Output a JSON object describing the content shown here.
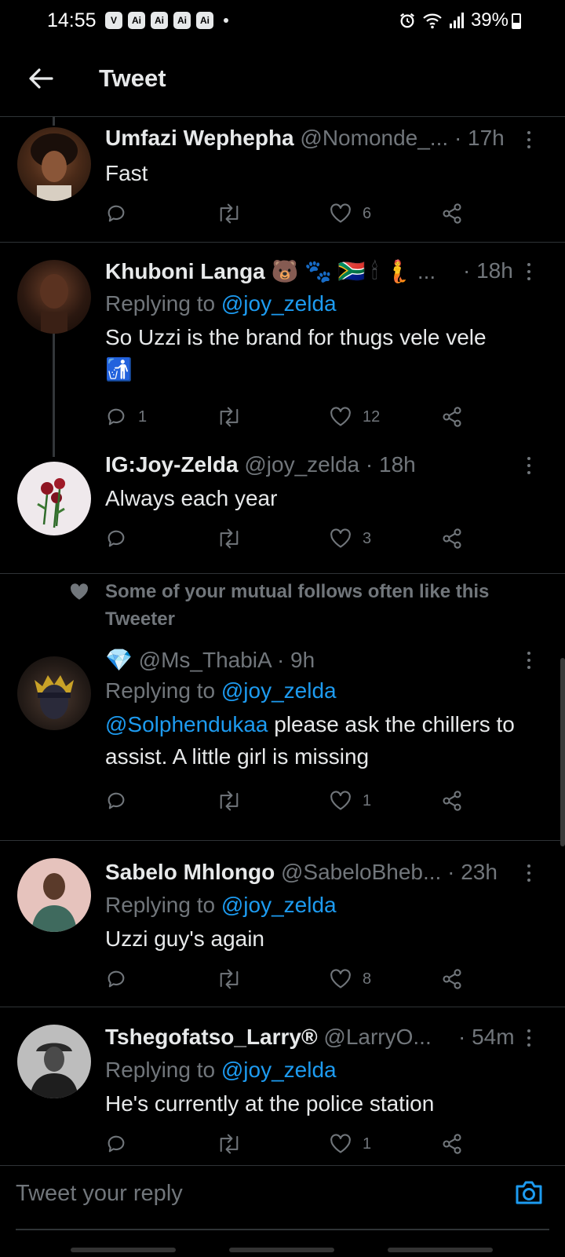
{
  "status_bar": {
    "time": "14:55",
    "apps": [
      "V",
      "Ai",
      "Ai",
      "Ai",
      "Ai"
    ],
    "battery": "39%"
  },
  "header": {
    "title": "Tweet"
  },
  "social_context": {
    "text": "Some of your mutual follows often like this Tweeter"
  },
  "tweets": [
    {
      "name": "Umfazi Wephepha",
      "handle": "@Nomonde_...",
      "time": "· 17h",
      "text": "Fast",
      "replies": "",
      "likes": "6"
    },
    {
      "name": "Khuboni Langa",
      "name_emoji": "🐻 🐾 🇿🇦 🕯 🧜 ...",
      "handle": "",
      "time": "· 18h",
      "replying_prefix": "Replying to",
      "replying_to": "@joy_zelda",
      "text": "So Uzzi is the brand for thugs vele vele",
      "text_emoji": "🚮",
      "replies": "1",
      "likes": "12"
    },
    {
      "name": "IG:Joy-Zelda",
      "handle": "@joy_zelda",
      "time": "· 18h",
      "text": "Always each year",
      "replies": "",
      "likes": "3"
    },
    {
      "name": "💎",
      "handle": "@Ms_ThabiA",
      "time": "· 9h",
      "replying_prefix": "Replying to",
      "replying_to": "@joy_zelda",
      "text_mention": "@Solphendukaa",
      "text": " please ask the chillers to assist. A little girl is missing",
      "replies": "",
      "likes": "1"
    },
    {
      "name": "Sabelo Mhlongo",
      "handle": "@SabeloBheb...",
      "time": "· 23h",
      "replying_prefix": "Replying to",
      "replying_to": "@joy_zelda",
      "text": "Uzzi guy's again",
      "replies": "",
      "likes": "8"
    },
    {
      "name": "Tshegofatso_Larry®",
      "handle": "@LarryO...",
      "time": "· 54m",
      "replying_prefix": "Replying to",
      "replying_to": "@joy_zelda",
      "text": "He's currently at the police station",
      "replies": "",
      "likes": "1"
    }
  ],
  "reply_bar": {
    "placeholder": "Tweet your reply"
  },
  "colors": {
    "background": "#000000",
    "text": "#e7e9ea",
    "muted": "#71767b",
    "accent": "#1d9bf0",
    "divider": "#2f3336"
  },
  "icons": [
    "back-arrow-icon",
    "reply-icon",
    "retweet-icon",
    "like-icon",
    "share-icon",
    "more-icon",
    "heart-icon",
    "camera-icon"
  ]
}
